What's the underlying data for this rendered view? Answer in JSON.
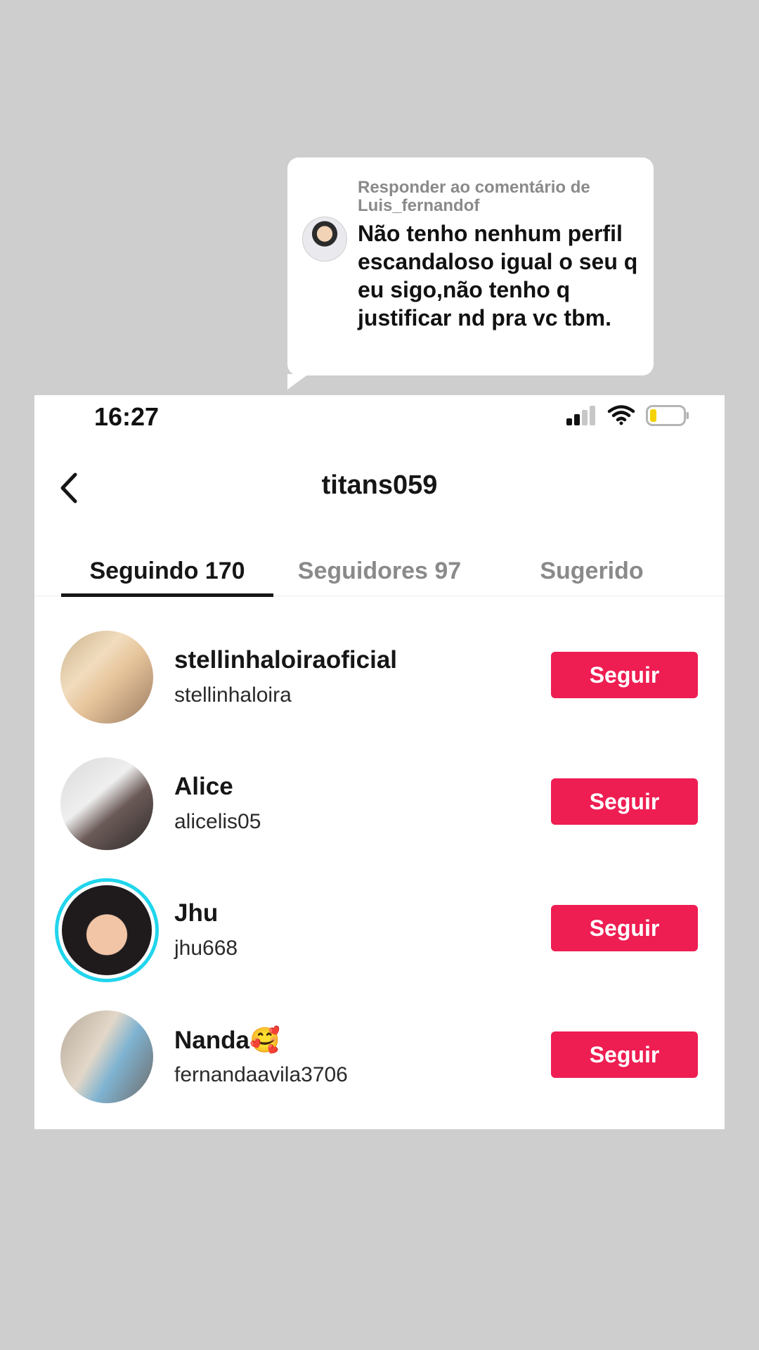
{
  "reply_bubble": {
    "header": "Responder ao comentário de Luis_fernandof",
    "text": "Não tenho nenhum perfil escandaloso igual o seu q eu sigo,não tenho q justificar nd pra vc tbm.",
    "avatar_icon": "profile-avatar"
  },
  "status_bar": {
    "time": "16:27",
    "icons": [
      "signal-icon",
      "wifi-icon",
      "battery-icon"
    ],
    "battery_level": 0.2,
    "battery_color": "#f5d200"
  },
  "header": {
    "title": "titans059",
    "back_icon": "chevron-left-icon"
  },
  "tabs": [
    {
      "label": "Seguindo 170",
      "active": true
    },
    {
      "label": "Seguidores 97",
      "active": false
    },
    {
      "label": "Sugerido",
      "active": false
    }
  ],
  "users": [
    {
      "name": "stellinhaloiraoficial",
      "handle": "stellinhaloira",
      "button": "Seguir",
      "has_story": false
    },
    {
      "name": "Alice",
      "handle": "alicelis05",
      "button": "Seguir",
      "has_story": false
    },
    {
      "name": "Jhu",
      "handle": "jhu668",
      "button": "Seguir",
      "has_story": true
    },
    {
      "name": "Nanda🥰",
      "handle": "fernandaavila3706",
      "button": "Seguir",
      "has_story": false
    }
  ],
  "colors": {
    "accent": "#ee1d52",
    "story_ring": "#20d5ec",
    "background": "#cecece"
  }
}
